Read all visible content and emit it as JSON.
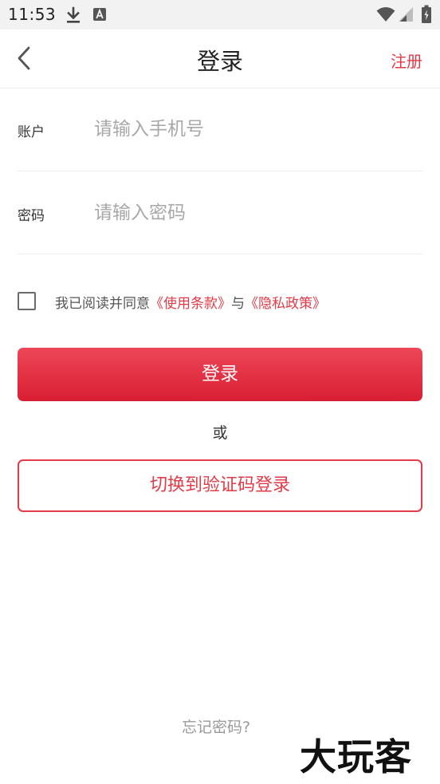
{
  "status_bar": {
    "time": "11:53",
    "icons": [
      "download-icon",
      "text-notification-icon",
      "wifi-icon",
      "signal-icon",
      "battery-icon"
    ]
  },
  "nav": {
    "title": "登录",
    "register_label": "注册"
  },
  "form": {
    "account_label": "账户",
    "account_placeholder": "请输入手机号",
    "password_label": "密码",
    "password_placeholder": "请输入密码"
  },
  "agreement": {
    "checked": false,
    "prefix": "我已阅读并同意",
    "terms_link": "《使用条款》",
    "connector": "与",
    "privacy_link": "《隐私政策》"
  },
  "login_button_label": "登录",
  "or_text": "或",
  "switch_button_label": "切换到验证码登录",
  "forgot_password_label": "忘记密码?",
  "watermark_text": "大玩客",
  "colors": {
    "accent": "#e23a46",
    "button_top": "#ee4757",
    "button_bottom": "#d81e32",
    "status_bar_bg": "#f2f2f2"
  }
}
